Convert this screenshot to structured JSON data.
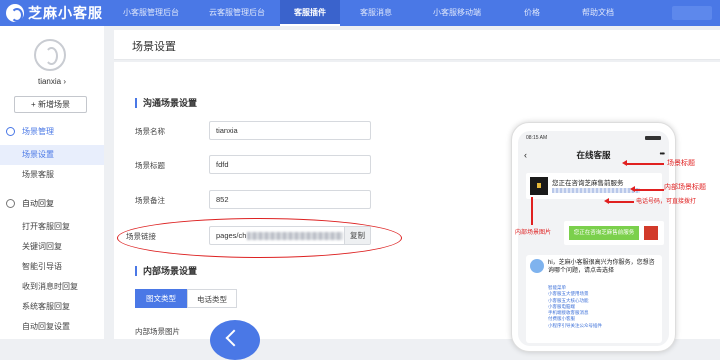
{
  "app": {
    "logo_text": "芝麻小客服"
  },
  "nav": {
    "items": [
      "小客服管理后台",
      "云客服管理后台",
      "客服插件",
      "客服消息",
      "小客服移动端",
      "价格",
      "帮助文档"
    ],
    "active": "客服插件"
  },
  "sidebar": {
    "username": "tianxia",
    "username_chevron": "›",
    "add_button": "+ 新增场景",
    "groups": [
      {
        "label": "场景管理",
        "icon": "scene-icon",
        "items": [
          "场景设置",
          "场景客服"
        ]
      },
      {
        "label": "自动回复",
        "icon": "auto-reply-icon",
        "items": [
          "打开客服回复",
          "关键词回复",
          "智能引导语",
          "收到消息时回复",
          "系统客服回复",
          "自动回复设置"
        ]
      }
    ],
    "selected_item": "场景设置"
  },
  "page": {
    "title": "场景设置"
  },
  "sections": {
    "communication": {
      "title": "沟通场景设置",
      "fields": [
        {
          "label": "场景名称",
          "value": "tianxia"
        },
        {
          "label": "场景标题",
          "value": "fdfd"
        },
        {
          "label": "场景备注",
          "value": "852"
        },
        {
          "label": "场景链接",
          "value": "pages/ch",
          "tail": "l",
          "copy_label": "复制"
        }
      ]
    },
    "internal": {
      "title": "内部场景设置",
      "tabs": [
        "图文类型",
        "电话类型"
      ],
      "image_label": "内部场景图片"
    }
  },
  "phone": {
    "time": "08:15 AM",
    "title": "在线客服",
    "back": "‹",
    "dots": "•••",
    "card_title": "您正在咨询芝麻售前服务",
    "green_button": "您正在咨询芝麻售前服务",
    "message": "hi，芝麻小客服很高兴为你服务，您想咨询哪个问题，请点击选择",
    "links": [
      "智能菜单",
      "小客服五大使用场景",
      "小客服五大核心功能",
      "小客服电脑端",
      "手机端接收客服消息",
      "付费版小客服",
      "小程序引导关注公众号插件"
    ]
  },
  "annotations": {
    "scene_title": "场景标题",
    "internal_title": "内部场景标题",
    "phone_note": "电话号码，可直接拨打",
    "internal_image": "内部场景图片"
  },
  "colors": {
    "primary": "#4a78e6",
    "annotation": "#e02020"
  }
}
